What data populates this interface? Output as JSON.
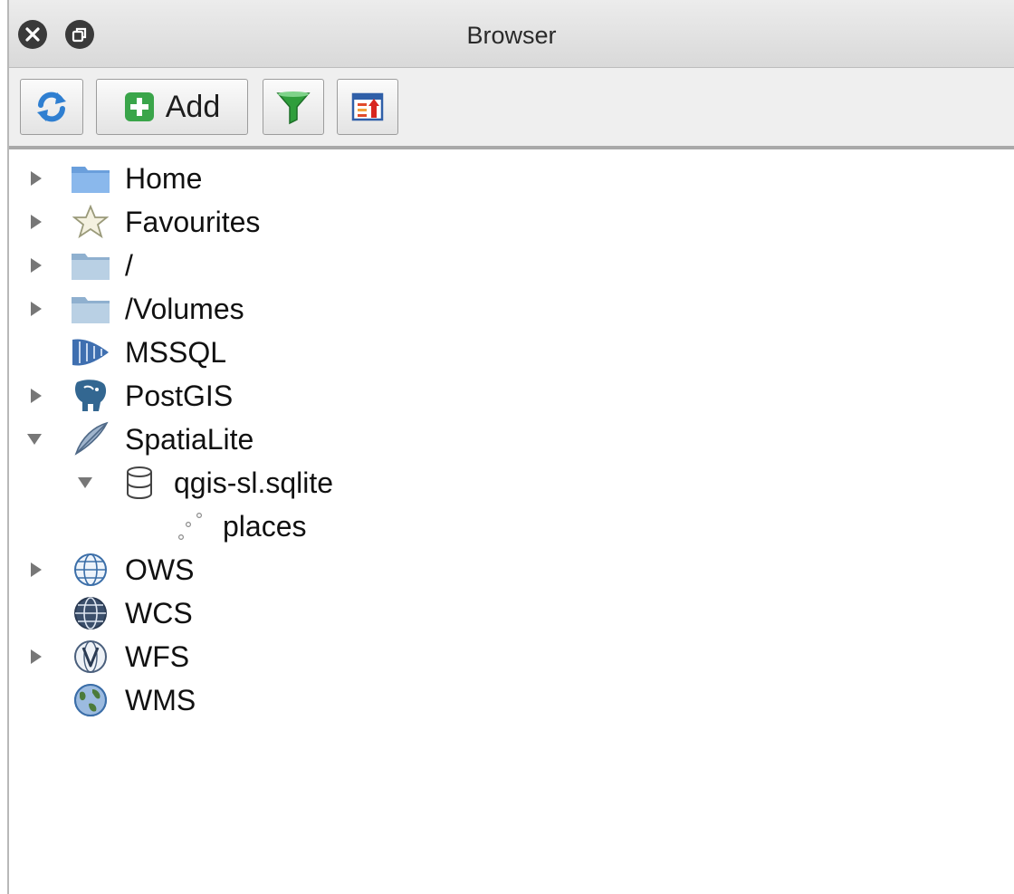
{
  "window": {
    "title": "Browser",
    "close_icon": "close-icon",
    "restore_icon": "restore-icon"
  },
  "toolbar": {
    "refresh_icon": "refresh-icon",
    "add_label": "Add",
    "add_icon": "plus-icon",
    "filter_icon": "filter-icon",
    "collapse_icon": "collapse-all-icon"
  },
  "tree": {
    "items": [
      {
        "label": "Home",
        "icon": "home-folder-icon",
        "expander": "collapsed",
        "level": 0
      },
      {
        "label": "Favourites",
        "icon": "star-icon",
        "expander": "collapsed",
        "level": 0
      },
      {
        "label": "/",
        "icon": "folder-icon",
        "expander": "collapsed",
        "level": 0
      },
      {
        "label": "/Volumes",
        "icon": "folder-icon",
        "expander": "collapsed",
        "level": 0
      },
      {
        "label": "MSSQL",
        "icon": "mssql-icon",
        "expander": "none",
        "level": 0
      },
      {
        "label": "PostGIS",
        "icon": "postgis-elephant-icon",
        "expander": "collapsed",
        "level": 0
      },
      {
        "label": "SpatiaLite",
        "icon": "feather-icon",
        "expander": "expanded",
        "level": 0
      },
      {
        "label": "qgis-sl.sqlite",
        "icon": "database-icon",
        "expander": "expanded",
        "level": 1
      },
      {
        "label": "places",
        "icon": "point-layer-icon",
        "expander": "none",
        "level": 2
      },
      {
        "label": "OWS",
        "icon": "globe-icon",
        "expander": "collapsed",
        "level": 0
      },
      {
        "label": "WCS",
        "icon": "wcs-globe-icon",
        "expander": "none",
        "level": 0
      },
      {
        "label": "WFS",
        "icon": "wfs-globe-icon",
        "expander": "collapsed",
        "level": 0
      },
      {
        "label": "WMS",
        "icon": "wms-globe-icon",
        "expander": "none",
        "level": 0
      }
    ]
  },
  "colors": {
    "folder_blue": "#6a9fdc",
    "folder_gray": "#a9c0d6",
    "add_green": "#3aa54a",
    "filter_green": "#2f9e3c",
    "refresh_blue": "#2f7fd1"
  }
}
